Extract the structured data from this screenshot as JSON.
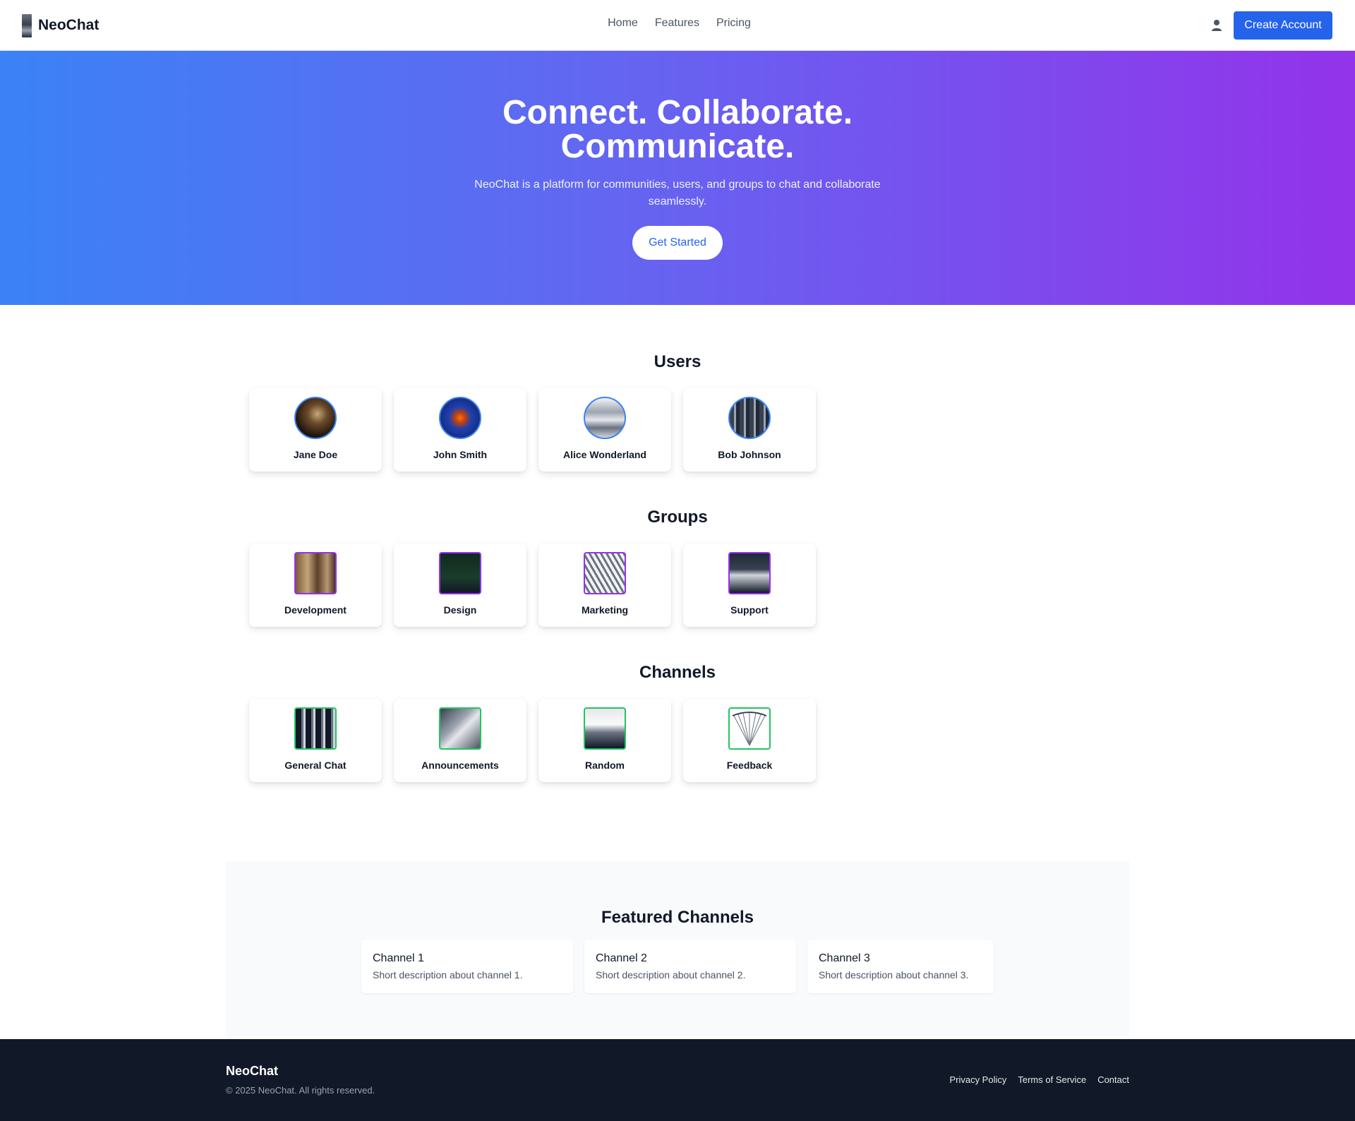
{
  "nav": {
    "brand": "NeoChat",
    "links": [
      "Home",
      "Features",
      "Pricing"
    ],
    "user_icon": "user-icon",
    "create_account": "Create Account"
  },
  "hero": {
    "title_line1": "Connect. Collaborate.",
    "title_line2": "Communicate.",
    "subtitle": "NeoChat is a platform for communities, users, and groups to chat and collaborate seamlessly.",
    "cta": "Get Started"
  },
  "users": {
    "title": "Users",
    "items": [
      "Jane Doe",
      "John Smith",
      "Alice Wonderland",
      "Bob Johnson"
    ]
  },
  "groups": {
    "title": "Groups",
    "items": [
      "Development",
      "Design",
      "Marketing",
      "Support"
    ]
  },
  "channels": {
    "title": "Channels",
    "items": [
      "General Chat",
      "Announcements",
      "Random",
      "Feedback"
    ]
  },
  "featured": {
    "title": "Featured Channels",
    "items": [
      {
        "title": "Channel 1",
        "desc": "Short description about channel 1."
      },
      {
        "title": "Channel 2",
        "desc": "Short description about channel 2."
      },
      {
        "title": "Channel 3",
        "desc": "Short description about channel 3."
      }
    ]
  },
  "footer": {
    "brand": "NeoChat",
    "copyright": "© 2025 NeoChat. All rights reserved.",
    "links": [
      "Privacy Policy",
      "Terms of Service",
      "Contact"
    ]
  },
  "colors": {
    "primary": "#2563eb",
    "hero_gradient_start": "#3b82f6",
    "hero_gradient_end": "#9333ea",
    "user_border": "#3b82f6",
    "group_border": "#9333ea",
    "channel_border": "#22c55e",
    "footer_bg": "#111827"
  }
}
